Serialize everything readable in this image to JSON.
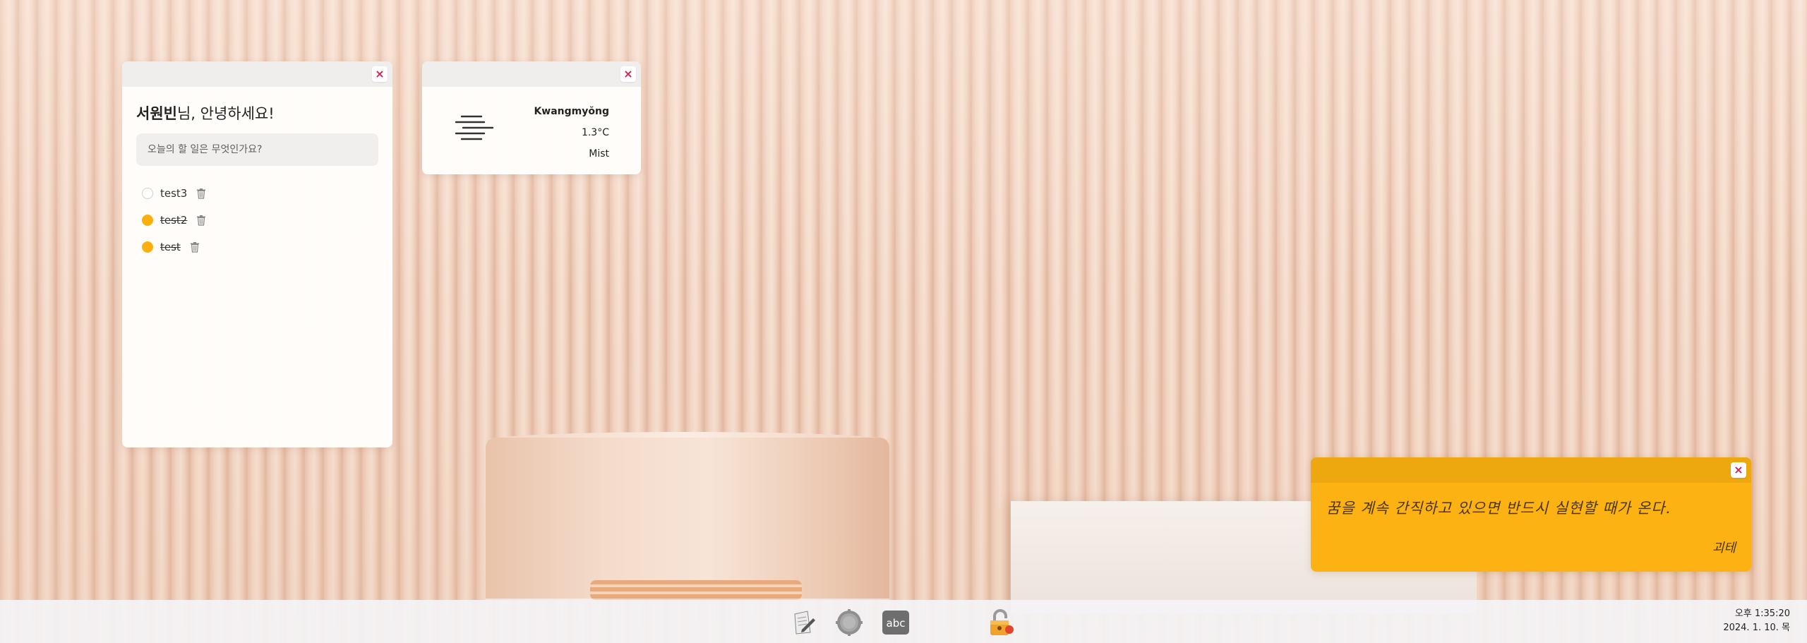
{
  "todo": {
    "username": "서원빈",
    "greeting_suffix": "님, 안녕하세요!",
    "close_label": "×",
    "input_placeholder": "오늘의 할 일은 무엇인가요?",
    "items": [
      {
        "text": "test3",
        "done": false
      },
      {
        "text": "test2",
        "done": true
      },
      {
        "text": "test",
        "done": true
      }
    ]
  },
  "weather": {
    "close_label": "×",
    "city": "Kwangmyŏng",
    "temperature": "1.3°C",
    "condition": "Mist",
    "icon": "mist-icon"
  },
  "quote": {
    "close_label": "×",
    "text": "꿈을 계속 간직하고 있으면 반드시 실현할 때가 온다.",
    "author": "괴테"
  },
  "taskbar": {
    "apps": [
      {
        "name": "memo-app-icon"
      },
      {
        "name": "settings-gear-icon"
      },
      {
        "name": "abc-text-app-icon",
        "label": "abc"
      },
      {
        "name": "lock-icon"
      }
    ],
    "time": "오후 1:35:20",
    "date": "2024. 1. 10. 목"
  },
  "colors": {
    "accent_yellow": "#fcb212",
    "close_red": "#d6204e",
    "checked": "#fbb010"
  }
}
